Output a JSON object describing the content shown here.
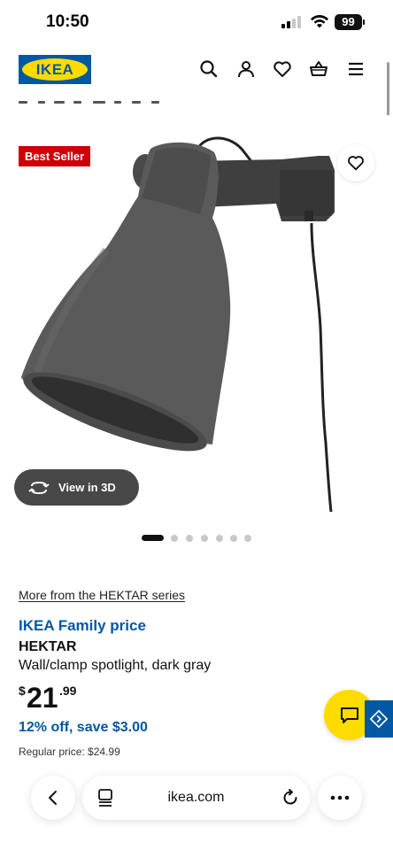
{
  "status_bar": {
    "time": "10:50",
    "battery": "99",
    "icons": [
      "cellular-signal-icon",
      "wifi-icon",
      "battery-icon"
    ]
  },
  "header": {
    "logo_text": "IKEA",
    "icons": [
      "search-icon",
      "account-icon",
      "heart-icon",
      "shopping-basket-icon",
      "menu-icon"
    ]
  },
  "gallery": {
    "badge": "Best Seller",
    "view_3d_label": "View in 3D",
    "image_count": 7,
    "active_image": 1
  },
  "product": {
    "series_link": "More from the HEKTAR series",
    "family_price_label": "IKEA Family price",
    "name": "HEKTAR",
    "description": "Wall/clamp spotlight, dark gray",
    "price_currency": "$",
    "price_integer": "21",
    "price_decimal": ".99",
    "discount": "12% off, save $3.00",
    "regular_price": "Regular price: $24.99"
  },
  "browser": {
    "url": "ikea.com"
  },
  "colors": {
    "ikea_blue": "#0058a3",
    "ikea_yellow": "#ffdb00",
    "badge_red": "#cc0008",
    "product_gray": "#5a5a5a"
  }
}
